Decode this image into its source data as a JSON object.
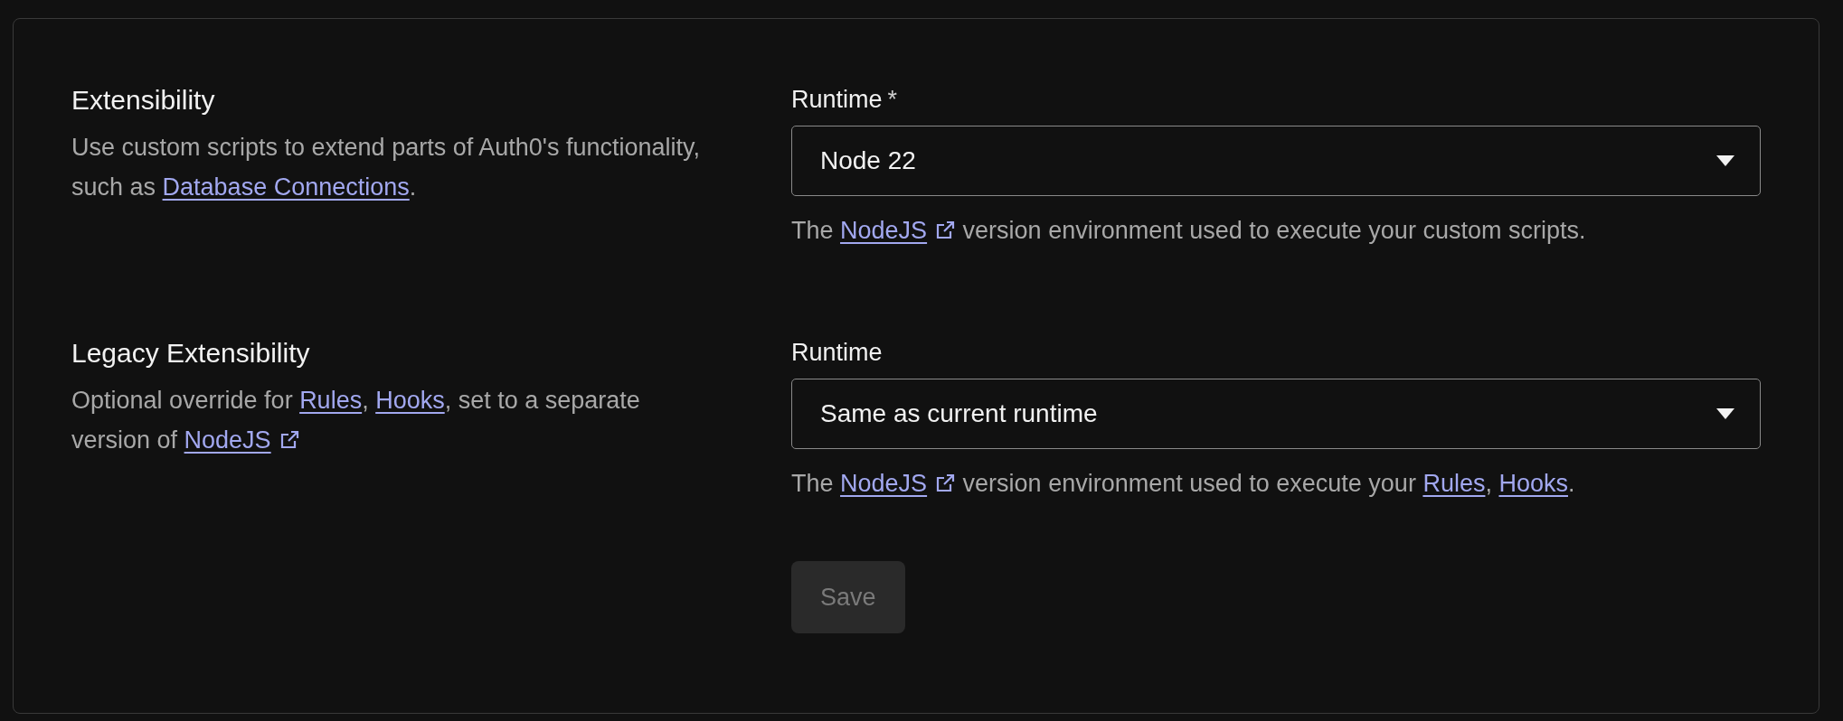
{
  "sections": [
    {
      "title": "Extensibility",
      "description": [
        {
          "kind": "text",
          "text": "Use custom scripts to extend parts of Auth0's functionality, such as "
        },
        {
          "kind": "link",
          "text": "Database Connections"
        },
        {
          "kind": "text",
          "text": "."
        }
      ],
      "field": {
        "label": "Runtime",
        "required_mark": "*",
        "value": "Node 22",
        "help": [
          {
            "kind": "text",
            "text": "The "
          },
          {
            "kind": "link",
            "text": "NodeJS",
            "external": true
          },
          {
            "kind": "text",
            "text": " version environment used to execute your custom scripts."
          }
        ]
      }
    },
    {
      "title": "Legacy Extensibility",
      "description": [
        {
          "kind": "text",
          "text": "Optional override for "
        },
        {
          "kind": "link",
          "text": "Rules"
        },
        {
          "kind": "text",
          "text": ", "
        },
        {
          "kind": "link",
          "text": "Hooks"
        },
        {
          "kind": "text",
          "text": ", set to a separate version of "
        },
        {
          "kind": "link",
          "text": "NodeJS",
          "external": true
        }
      ],
      "field": {
        "label": "Runtime",
        "value": "Same as current runtime",
        "help": [
          {
            "kind": "text",
            "text": "The "
          },
          {
            "kind": "link",
            "text": "NodeJS",
            "external": true
          },
          {
            "kind": "text",
            "text": " version environment used to execute your "
          },
          {
            "kind": "link",
            "text": "Rules",
            "suffix": ", "
          },
          {
            "kind": "link",
            "text": "Hooks",
            "suffix": "."
          }
        ]
      }
    }
  ],
  "save_button": {
    "label": "Save",
    "disabled": true
  }
}
